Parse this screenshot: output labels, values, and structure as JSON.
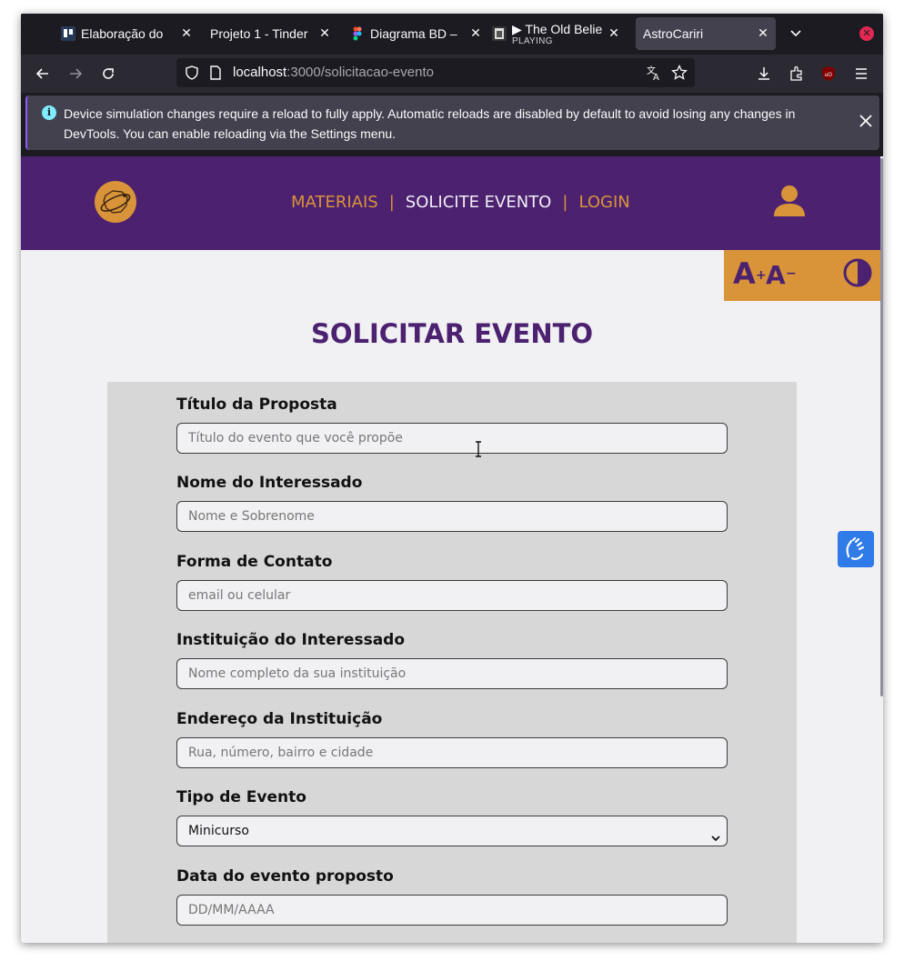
{
  "browser": {
    "tabs": [
      {
        "label": "Elaboração do",
        "icon": "trello-icon"
      },
      {
        "label": "Projeto 1 - Tinder P",
        "icon": "none"
      },
      {
        "label": "Diagrama BD –",
        "icon": "figma-icon"
      },
      {
        "label": "▶ The Old Belie",
        "sublabel": "PLAYING",
        "icon": "music-icon"
      },
      {
        "label": "AstroCariri",
        "icon": "none",
        "active": true
      }
    ],
    "url_host": "localhost",
    "url_path": ":3000/solicitacao-evento",
    "notification": "Device simulation changes require a reload to fully apply. Automatic reloads are disabled by default to avoid losing any changes in DevTools. You can enable reloading via the Settings menu."
  },
  "site": {
    "menu": {
      "materiais": "MATERIAIS",
      "solicite": "SOLICITE EVENTO",
      "login": "LOGIN",
      "sep": "|"
    },
    "a11y": {
      "increase": "A",
      "increase_sup": "+",
      "decrease": "A",
      "decrease_sup": "−"
    },
    "title": "SOLICITAR EVENTO",
    "form": {
      "titulo": {
        "label": "Título da Proposta",
        "placeholder": "Título do evento que você propõe"
      },
      "nome": {
        "label": "Nome do Interessado",
        "placeholder": "Nome e Sobrenome"
      },
      "contato": {
        "label": "Forma de Contato",
        "placeholder": "email ou celular"
      },
      "instituicao": {
        "label": "Instituição do Interessado",
        "placeholder": "Nome completo da sua instituição"
      },
      "endereco": {
        "label": "Endereço da Instituição",
        "placeholder": "Rua, número, bairro e cidade"
      },
      "tipo": {
        "label": "Tipo de Evento",
        "value": "Minicurso"
      },
      "data": {
        "label": "Data do evento proposto",
        "placeholder": "DD/MM/AAAA"
      }
    },
    "colors": {
      "primary": "#4b2170",
      "accent": "#d9943a",
      "form_bg": "#d7d7d7"
    }
  }
}
